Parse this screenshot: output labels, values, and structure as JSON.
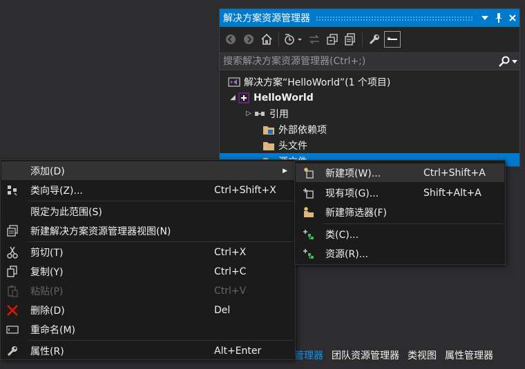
{
  "solution_explorer": {
    "title": "解决方案资源管理器",
    "search_placeholder": "搜索解决方案资源管理器(Ctrl+;)",
    "tree": [
      {
        "label": "解决方案“HelloWorld”(1 个项目)",
        "icon": "solution-icon"
      },
      {
        "label": "HelloWorld",
        "icon": "cpp-project-icon"
      },
      {
        "label": "引用",
        "icon": "references-icon"
      },
      {
        "label": "外部依赖项",
        "icon": "folder-icon"
      },
      {
        "label": "头文件",
        "icon": "folder-icon"
      },
      {
        "label": "源文件",
        "icon": "folder-icon"
      }
    ]
  },
  "context_menu": {
    "items": [
      {
        "label": "添加(D)",
        "shortcut": "",
        "icon": "",
        "submenu": true
      },
      {
        "label": "类向导(Z)...",
        "shortcut": "Ctrl+Shift+X",
        "icon": "class-wizard-icon"
      },
      {
        "label": "限定为此范围(S)",
        "shortcut": "",
        "icon": ""
      },
      {
        "label": "新建解决方案资源管理器视图(N)",
        "shortcut": "",
        "icon": "new-view-icon"
      },
      {
        "label": "剪切(T)",
        "shortcut": "Ctrl+X",
        "icon": "scissors-icon"
      },
      {
        "label": "复制(Y)",
        "shortcut": "Ctrl+C",
        "icon": "copy-icon"
      },
      {
        "label": "粘贴(P)",
        "shortcut": "Ctrl+V",
        "icon": "paste-icon",
        "disabled": true
      },
      {
        "label": "删除(D)",
        "shortcut": "Del",
        "icon": "delete-icon"
      },
      {
        "label": "重命名(M)",
        "shortcut": "",
        "icon": "rename-icon"
      },
      {
        "label": "属性(R)",
        "shortcut": "Alt+Enter",
        "icon": "wrench-icon"
      }
    ]
  },
  "submenu": {
    "items": [
      {
        "label": "新建项(W)...",
        "shortcut": "Ctrl+Shift+A",
        "icon": "new-item-icon"
      },
      {
        "label": "现有项(G)...",
        "shortcut": "Shift+Alt+A",
        "icon": "existing-item-icon"
      },
      {
        "label": "新建筛选器(F)",
        "shortcut": "",
        "icon": "new-filter-icon"
      },
      {
        "label": "类(C)...",
        "shortcut": "",
        "icon": "add-class-icon"
      },
      {
        "label": "资源(R)...",
        "shortcut": "",
        "icon": "add-resource-icon"
      }
    ]
  },
  "bottom_tabs": [
    "管理器",
    "团队资源管理器",
    "类视图",
    "属性管理器"
  ],
  "colors": {
    "accent": "#007acc",
    "menu_bg": "#1b1b1c",
    "background": "#2d2d30"
  }
}
